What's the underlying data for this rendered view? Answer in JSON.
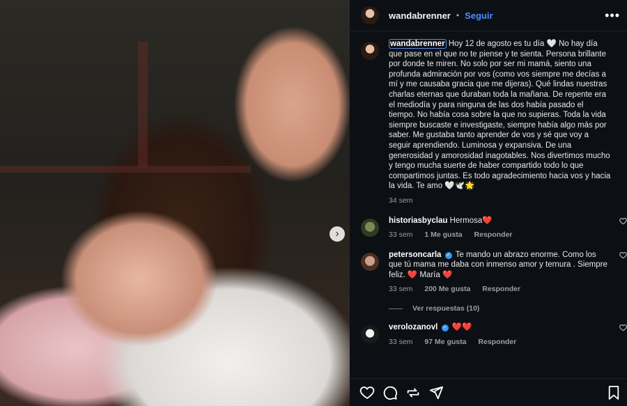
{
  "post": {
    "username": "wandabrenner",
    "separator": "•",
    "follow_label": "Seguir",
    "more_label": "•••",
    "caption": "Hoy 12 de agosto es tu día 🤍 No hay día que pase en el que no te piense y te sienta. Persona brillante por donde te miren. No solo por ser mi mamá, siento una profunda admiración por vos (como vos siempre me decías a mí y me causaba gracia que me dijeras). Qué lindas nuestras charlas eternas que duraban toda la mañana. De repente era el mediodía y para ninguna de las dos había pasado el tiempo. No había cosa sobre la que no supieras. Toda la vida siempre buscaste e investigaste, siempre había algo más por saber. Me gustaba tanto aprender de vos y sé que voy a seguir aprendiendo. Luminosa y expansiva. De una generosidad y amorosidad inagotables. Nos divertimos mucho y tengo mucha suerte de haber compartido todo lo que compartimos juntas. Es todo agradecimiento hacia vos y hacia la vida. Te amo 🤍🕊️🌟",
    "caption_time": "34 sem",
    "carousel_next": "›"
  },
  "comments": [
    {
      "user": "historiasbyclau",
      "verified": false,
      "text": "Hermosa❤️",
      "time": "33 sem",
      "likes": "1 Me gusta",
      "reply": "Responder"
    },
    {
      "user": "petersoncarla",
      "verified": true,
      "text": "Te mando un abrazo enorme. Como los que tú mama me daba con inmenso amor y ternura . Siempre feliz. ❤️ María ❤️",
      "time": "33 sem",
      "likes": "200 Me gusta",
      "reply": "Responder"
    },
    {
      "user": "verolozanovl",
      "verified": true,
      "text": "❤️❤️",
      "time": "33 sem",
      "likes": "97 Me gusta",
      "reply": "Responder"
    }
  ],
  "view_replies": "Ver respuestas (10)",
  "icons": {
    "like": "heart-icon",
    "comment": "comment-icon",
    "share": "share-icon",
    "send": "send-icon",
    "save": "bookmark-icon",
    "comment_like": "heart-outline-icon",
    "verified": "verified-badge-icon"
  },
  "colors": {
    "accent": "#4f8dff",
    "verified": "#3897f0",
    "panel": "#0c0f14"
  }
}
